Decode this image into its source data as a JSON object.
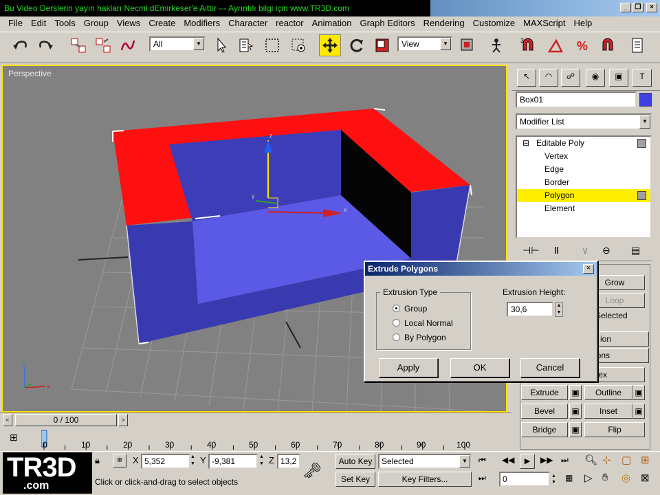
{
  "window": {
    "title": "Bu Video Derslerin yayın hakları Necmi dEmirkeser'e Aittir --- Ayrıntılı bilgi için www.TR3D.com"
  },
  "menu": [
    "File",
    "Edit",
    "Tools",
    "Group",
    "Views",
    "Create",
    "Modifiers",
    "Character",
    "reactor",
    "Animation",
    "Graph Editors",
    "Rendering",
    "Customize",
    "MAXScript",
    "Help"
  ],
  "toolbar": {
    "selection_filter": "All",
    "ref_coord": "View"
  },
  "viewport": {
    "label": "Perspective",
    "axis_labels": {
      "x": "x",
      "y": "y",
      "z": "z"
    }
  },
  "command_panel": {
    "object_name": "Box01",
    "object_color": "#4040e0",
    "modifier_list": "Modifier List",
    "stack": [
      {
        "label": "Editable Poly",
        "prefix": "⊟"
      },
      {
        "label": "Vertex"
      },
      {
        "label": "Edge"
      },
      {
        "label": "Border"
      },
      {
        "label": "Polygon",
        "selected": true
      },
      {
        "label": "Element"
      }
    ],
    "buttons": {
      "grow": "Grow",
      "loop": "Loop",
      "as_selected": "as Selected",
      "partial1": "ion",
      "partial2": "ons",
      "partial3": "ex",
      "extrude": "Extrude",
      "outline": "Outline",
      "bevel": "Bevel",
      "inset": "Inset",
      "bridge": "Bridge",
      "flip": "Flip"
    }
  },
  "dialog": {
    "title": "Extrude Polygons",
    "group_label": "Extrusion Type",
    "options": [
      "Group",
      "Local Normal",
      "By Polygon"
    ],
    "selected_option": "Group",
    "height_label": "Extrusion Height:",
    "height_value": "30,6",
    "apply": "Apply",
    "ok": "OK",
    "cancel": "Cancel"
  },
  "timeline": {
    "frame": "0 / 100",
    "ticks": [
      "0",
      "10",
      "20",
      "30",
      "40",
      "50",
      "60",
      "70",
      "80",
      "90",
      "100"
    ]
  },
  "status": {
    "x_label": "X",
    "x_value": "5,352",
    "y_label": "Y",
    "y_value": "-9,381",
    "z_label": "Z",
    "z_value": "13,2",
    "prompt": "Click or click-and-drag to select objects",
    "auto_key": "Auto Key",
    "set_key": "Set Key",
    "key_mode": "Selected",
    "key_filters": "Key Filters...",
    "current_frame": "0"
  },
  "logo": {
    "main": "TR3D",
    "sub": ".com"
  }
}
